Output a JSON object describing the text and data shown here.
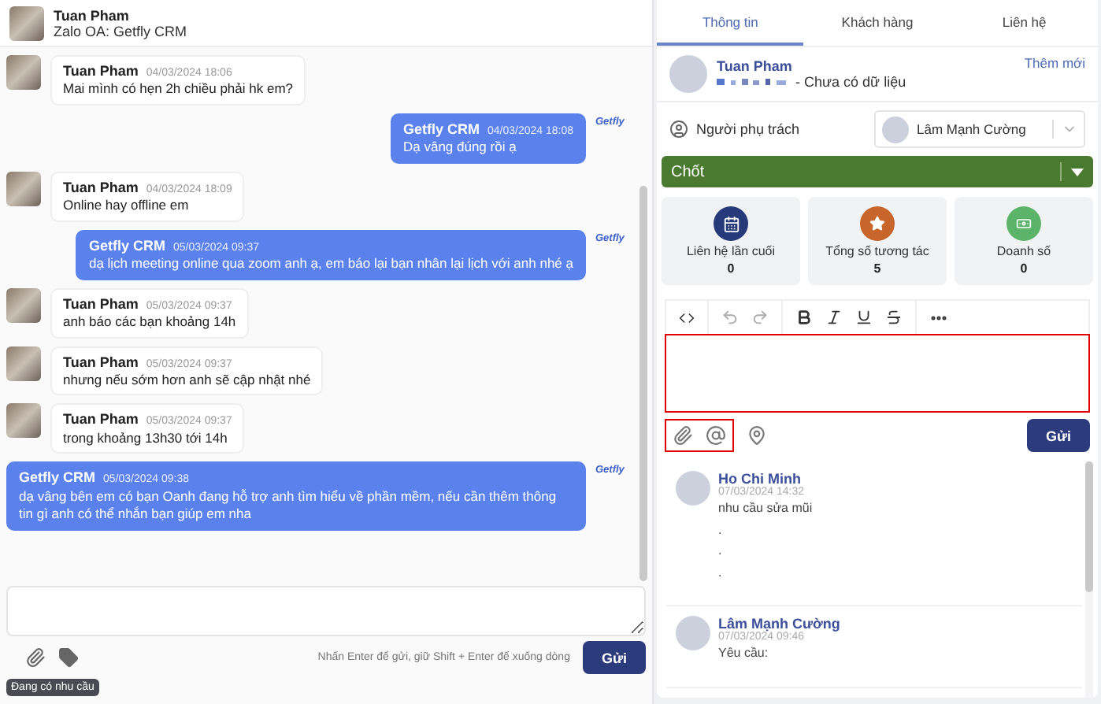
{
  "chat": {
    "contact": {
      "name": "Tuan Pham",
      "subtitle": "Zalo OA: Getfly CRM"
    },
    "messages": [
      {
        "kind": "in",
        "sender": "Tuan Pham",
        "time": "04/03/2024 18:06",
        "text": "Mai mình có hẹn 2h chiều phải hk em?"
      },
      {
        "kind": "out",
        "sender": "Getfly CRM",
        "time": "04/03/2024 18:08",
        "text": "Dạ vâng đúng rồi ạ",
        "logo": "Getfly"
      },
      {
        "kind": "in",
        "sender": "Tuan Pham",
        "time": "04/03/2024 18:09",
        "text": "Online hay offline em"
      },
      {
        "kind": "out",
        "sender": "Getfly CRM",
        "time": "05/03/2024 09:37",
        "text": "dạ lịch meeting online qua zoom anh ạ, em báo lại bạn nhân lại lịch với anh nhé ạ",
        "logo": "Getfly"
      },
      {
        "kind": "in",
        "sender": "Tuan Pham",
        "time": "05/03/2024 09:37",
        "text": "anh báo các bạn khoảng 14h"
      },
      {
        "kind": "in",
        "sender": "Tuan Pham",
        "time": "05/03/2024 09:37",
        "text": "nhưng nếu sớm hơn anh sẽ cập nhật nhé"
      },
      {
        "kind": "in",
        "sender": "Tuan Pham",
        "time": "05/03/2024 09:37",
        "text": "trong khoảng 13h30 tới 14h"
      },
      {
        "kind": "out",
        "sender": "Getfly CRM",
        "time": "05/03/2024 09:38",
        "text": "dạ vâng bên em có bạn Oanh đang hỗ trợ anh tìm hiểu về phần mềm, nếu cần thêm thông tin gì anh có thể nhắn bạn giúp em nha",
        "logo": "Getfly"
      }
    ],
    "hint": "Nhấn Enter để gửi, giữ Shift + Enter để xuống dòng",
    "send": "Gửi",
    "tag": "Đang có nhu cầu"
  },
  "panel": {
    "tabs": [
      {
        "label": "Thông tin",
        "selected": true
      },
      {
        "label": "Khách hàng",
        "selected": false
      },
      {
        "label": "Liên hệ",
        "selected": false
      }
    ],
    "customer": {
      "name": "Tuan Pham",
      "detail": "- Chưa có dữ liệu",
      "add": "Thêm mới"
    },
    "owner": {
      "label": "Người phụ trách",
      "value": "Lâm Mạnh Cường"
    },
    "stage": {
      "label": "Chốt",
      "color": "#4a7a2f"
    },
    "stats": [
      {
        "kind": "calendar",
        "label": "Liên hệ lần cuối",
        "value": "0",
        "color": "#263a7a"
      },
      {
        "kind": "star",
        "label": "Tổng số tương tác",
        "value": "5",
        "color": "#c8652a"
      },
      {
        "kind": "money",
        "label": "Doanh số",
        "value": "0",
        "color": "#5cb46a"
      }
    ],
    "send": "Gửi",
    "notes": [
      {
        "author": "Ho Chi Minh",
        "time": "07/03/2024 14:32",
        "lines": [
          "nhu cầu sửa mũi",
          ".",
          ".",
          "."
        ]
      },
      {
        "author": "Lâm Mạnh Cường",
        "time": "07/03/2024 09:46",
        "lines": [
          "Yêu cầu:"
        ]
      }
    ]
  }
}
